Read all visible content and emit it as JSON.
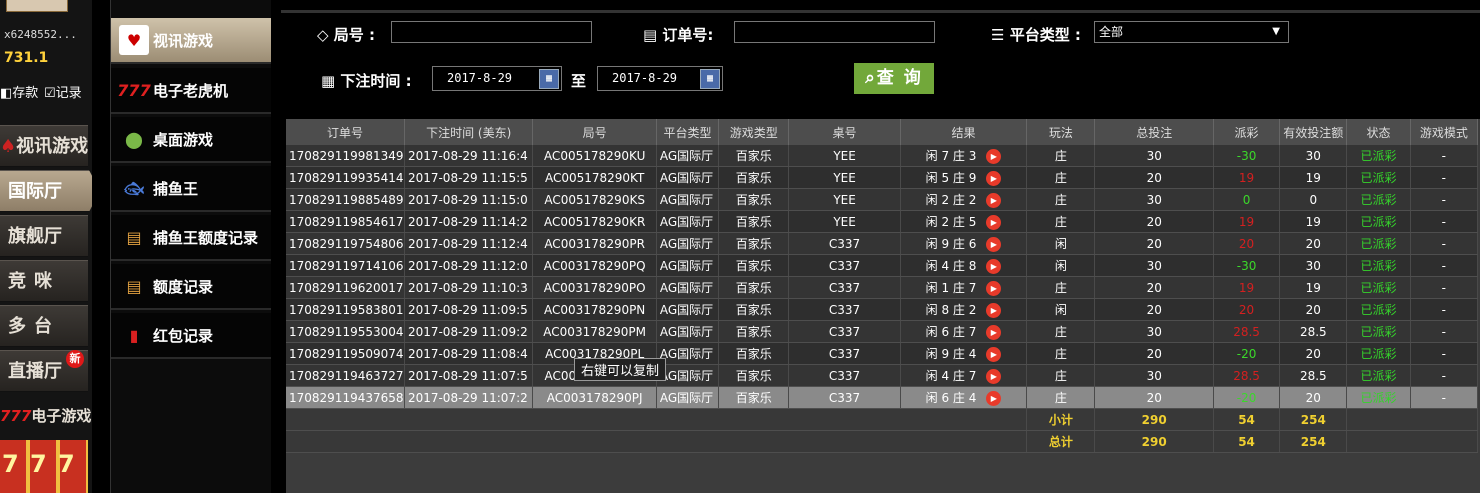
{
  "user": {
    "name": "x6248552...",
    "balance": "731.1",
    "deposit_label": "存款",
    "records_label": "记录"
  },
  "left_nav": [
    {
      "label": "视讯游戏",
      "active": false
    },
    {
      "label": "国际厅",
      "active": true
    },
    {
      "label": "旗舰厅",
      "active": false
    },
    {
      "label": "竞咪",
      "active": false
    },
    {
      "label": "多台",
      "active": false
    },
    {
      "label": "直播厅",
      "badge": "新",
      "active": false
    }
  ],
  "left_bottom": {
    "label": "电子游戏",
    "sevens": "777"
  },
  "menu": [
    {
      "label": "视讯游戏",
      "icon": "playing-cards-icon",
      "active": true
    },
    {
      "label": "电子老虎机",
      "icon": "777-slot-icon"
    },
    {
      "label": "桌面游戏",
      "icon": "poker-chip-icon"
    },
    {
      "label": "捕鱼王",
      "icon": "fish-icon"
    },
    {
      "label": "捕鱼王额度记录",
      "icon": "document-icon"
    },
    {
      "label": "额度记录",
      "icon": "document-icon"
    },
    {
      "label": "红包记录",
      "icon": "red-envelope-icon"
    }
  ],
  "filters": {
    "round_label": "局号 :",
    "round_value": "",
    "order_label": "订单号:",
    "order_value": "",
    "platform_label": "平台类型 :",
    "platform_value": "全部",
    "time_label": "下注时间 :",
    "date_from": "2017-8-29",
    "to_label": "至",
    "date_to": "2017-8-29",
    "query_label": "查 询"
  },
  "table": {
    "headers": [
      "订单号",
      "下注时间 (美东)",
      "局号",
      "平台类型",
      "游戏类型",
      "桌号",
      "结果",
      "玩法",
      "总投注",
      "派彩",
      "有效投注额",
      "状态",
      "游戏模式"
    ],
    "rows": [
      [
        "170829119981349",
        "2017-08-29 11:16:4",
        "AC005178290KU",
        "AG国际厅",
        "百家乐",
        "YEE",
        "闲 7 庄 3",
        "庄",
        "30",
        "-30",
        "30",
        "已派彩",
        "-"
      ],
      [
        "170829119935414",
        "2017-08-29 11:15:5",
        "AC005178290KT",
        "AG国际厅",
        "百家乐",
        "YEE",
        "闲 5 庄 9",
        "庄",
        "20",
        "19",
        "19",
        "已派彩",
        "-"
      ],
      [
        "170829119885489",
        "2017-08-29 11:15:0",
        "AC005178290KS",
        "AG国际厅",
        "百家乐",
        "YEE",
        "闲 2 庄 2",
        "庄",
        "30",
        "0",
        "0",
        "已派彩",
        "-"
      ],
      [
        "170829119854617",
        "2017-08-29 11:14:2",
        "AC005178290KR",
        "AG国际厅",
        "百家乐",
        "YEE",
        "闲 2 庄 5",
        "庄",
        "20",
        "19",
        "19",
        "已派彩",
        "-"
      ],
      [
        "170829119754806",
        "2017-08-29 11:12:4",
        "AC003178290PR",
        "AG国际厅",
        "百家乐",
        "C337",
        "闲 9 庄 6",
        "闲",
        "20",
        "20",
        "20",
        "已派彩",
        "-"
      ],
      [
        "170829119714106",
        "2017-08-29 11:12:0",
        "AC003178290PQ",
        "AG国际厅",
        "百家乐",
        "C337",
        "闲 4 庄 8",
        "闲",
        "30",
        "-30",
        "30",
        "已派彩",
        "-"
      ],
      [
        "170829119620017",
        "2017-08-29 11:10:3",
        "AC003178290PO",
        "AG国际厅",
        "百家乐",
        "C337",
        "闲 1 庄 7",
        "庄",
        "20",
        "19",
        "19",
        "已派彩",
        "-"
      ],
      [
        "170829119583801",
        "2017-08-29 11:09:5",
        "AC003178290PN",
        "AG国际厅",
        "百家乐",
        "C337",
        "闲 8 庄 2",
        "闲",
        "20",
        "20",
        "20",
        "已派彩",
        "-"
      ],
      [
        "170829119553004",
        "2017-08-29 11:09:2",
        "AC003178290PM",
        "AG国际厅",
        "百家乐",
        "C337",
        "闲 6 庄 7",
        "庄",
        "30",
        "28.5",
        "28.5",
        "已派彩",
        "-"
      ],
      [
        "170829119509074",
        "2017-08-29 11:08:4",
        "AC003178290PL",
        "AG国际厅",
        "百家乐",
        "C337",
        "闲 9 庄 4",
        "庄",
        "20",
        "-20",
        "20",
        "已派彩",
        "-"
      ],
      [
        "170829119463727",
        "2017-08-29 11:07:5",
        "AC003178290PK",
        "AG国际厅",
        "百家乐",
        "C337",
        "闲 4 庄 7",
        "庄",
        "30",
        "28.5",
        "28.5",
        "已派彩",
        "-"
      ],
      [
        "170829119437658",
        "2017-08-29 11:07:2",
        "AC003178290PJ",
        "AG国际厅",
        "百家乐",
        "C337",
        "闲 6 庄 4",
        "庄",
        "20",
        "-20",
        "20",
        "已派彩",
        "-"
      ]
    ],
    "subtotal": {
      "label": "小计",
      "total_bet": "290",
      "payout": "54",
      "valid_bet": "254"
    },
    "total": {
      "label": "总计",
      "total_bet": "290",
      "payout": "54",
      "valid_bet": "254"
    },
    "selected_row": 11
  },
  "tooltip": "右键可以复制",
  "colors": {
    "accent_green": "#72a83a",
    "payout_negative": "#3bd82a",
    "payout_positive": "#d42020",
    "status": "#35d32b",
    "sum_text": "#f0d030"
  }
}
